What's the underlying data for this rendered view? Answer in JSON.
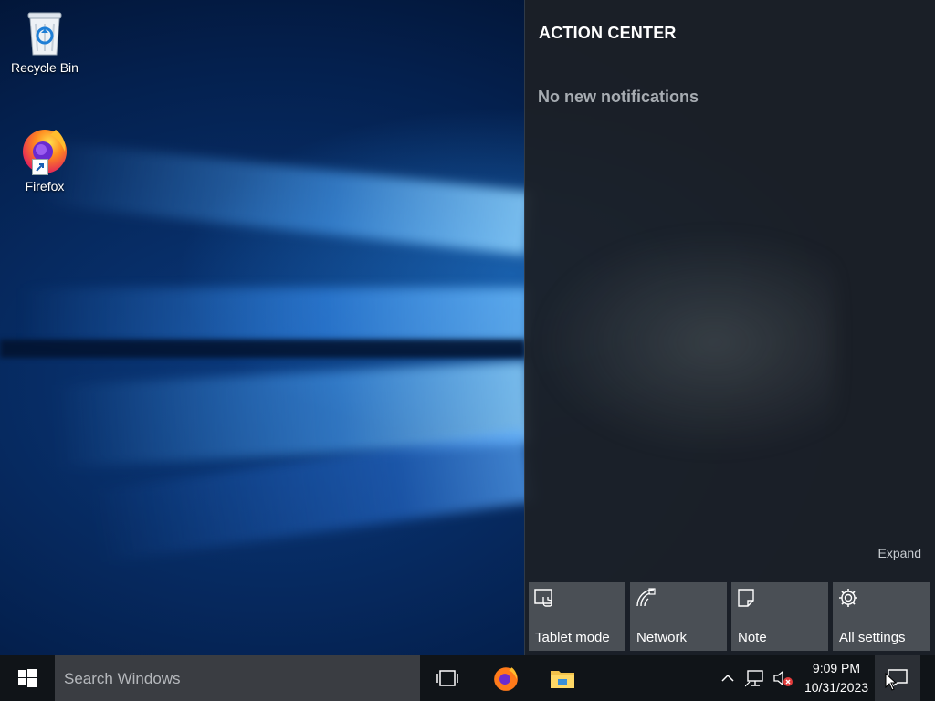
{
  "desktop": {
    "icons": [
      {
        "label": "Recycle Bin",
        "icon": "recycle-bin-icon"
      },
      {
        "label": "Firefox",
        "icon": "firefox-icon"
      }
    ]
  },
  "action_center": {
    "title": "ACTION CENTER",
    "empty_message": "No new notifications",
    "expand_label": "Expand",
    "quick_actions": [
      {
        "label": "Tablet mode",
        "icon": "tablet-mode-icon"
      },
      {
        "label": "Network",
        "icon": "network-icon"
      },
      {
        "label": "Note",
        "icon": "note-icon"
      },
      {
        "label": "All settings",
        "icon": "settings-gear-icon"
      }
    ]
  },
  "taskbar": {
    "search_placeholder": "Search Windows",
    "pinned": [
      "task-view-icon",
      "firefox-icon",
      "file-explorer-icon"
    ],
    "tray": {
      "time": "9:09 PM",
      "date": "10/31/2023"
    }
  },
  "colors": {
    "taskbar": "#101418",
    "action_center_bg": "#1c2026",
    "tile": "#4a4f55",
    "search_box": "#3a3d42"
  }
}
